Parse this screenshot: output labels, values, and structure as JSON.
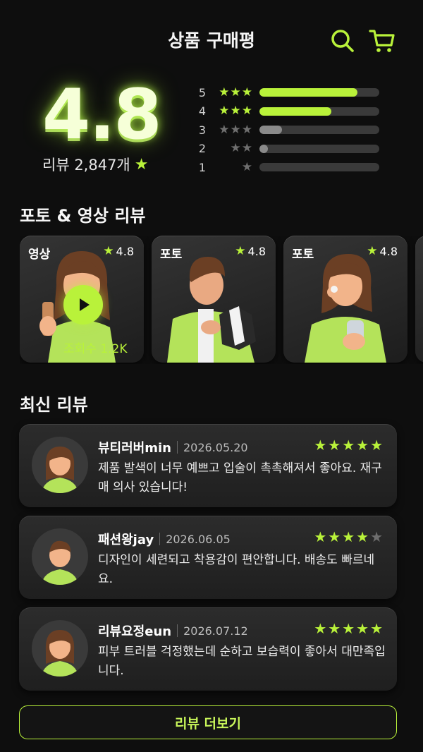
{
  "header": {
    "title": "상품 구매평",
    "search_icon": "search-icon",
    "cart_icon": "cart-icon",
    "accent": "#b9f23a"
  },
  "summary": {
    "average": "4.8",
    "review_count": "리뷰 2,847개",
    "distribution": [
      {
        "star": "5",
        "ratio": 0.82
      },
      {
        "star": "4",
        "ratio": 0.6
      },
      {
        "star": "3",
        "ratio": 0.19
      },
      {
        "star": "2",
        "ratio": 0.07
      },
      {
        "star": "1",
        "ratio": 0.0
      }
    ]
  },
  "media": {
    "title": "포토 & 영상 리뷰",
    "cards": [
      {
        "tag": "영상",
        "score": "4.8",
        "views": "조회수 1.2K"
      },
      {
        "tag": "포토",
        "score": "4.8"
      },
      {
        "tag": "포토",
        "score": "4.8"
      }
    ]
  },
  "latest": {
    "title": "최신 리뷰",
    "reviews": [
      {
        "name": "뷰티러버min",
        "date": "2026.05.20",
        "rating": 5,
        "text": "제품 발색이 너무 예쁘고 입술이 촉촉해져서 좋아요. 재구매 의사 있습니다!"
      },
      {
        "name": "패션왕jay",
        "date": "2026.06.05",
        "rating": 4,
        "text": "디자인이 세련되고 착용감이 편안합니다. 배송도 빠르네요."
      },
      {
        "name": "리뷰요정eun",
        "date": "2026.07.12",
        "rating": 5,
        "text": "피부 트러블 걱정했는데 순하고 보습력이 좋아서 대만족입니다."
      }
    ]
  },
  "more_button": "리뷰 더보기"
}
